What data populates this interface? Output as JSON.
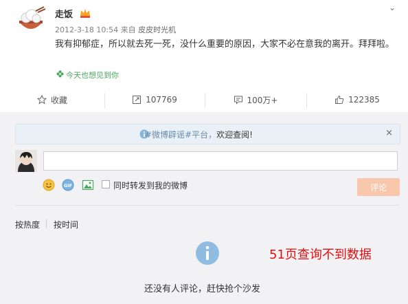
{
  "post": {
    "username": "走饭",
    "timestamp": "2012-3-18 10:54",
    "source_prefix": "来自",
    "source": "皮皮时光机",
    "text": "我有抑郁症，所以就去死一死，没什么重要的原因，大家不必在意我的离开。拜拜啦。",
    "location_line": "今天也想见到你"
  },
  "actions": {
    "favorite_label": "收藏",
    "repost_count": "107769",
    "comment_count": "100万+",
    "like_count": "122385"
  },
  "notice": {
    "hashtag": "#微博辟谣#平台，",
    "welcome": "欢迎查阅!",
    "close": "×"
  },
  "composer": {
    "input_value": "",
    "repost_checkbox_label": "同时转发到我的微博",
    "send_button": "评论",
    "repost_checked": false
  },
  "sort": {
    "by_hot": "按热度",
    "by_time": "按时间"
  },
  "empty_state": {
    "message": "还没有人评论，赶快抢个沙发"
  },
  "annotation": {
    "text": "51页查询不到数据",
    "color": "#e01010"
  },
  "colors": {
    "accent_send": "#f8c7ac",
    "location_green": "#4aa85e",
    "notice_blue": "#6a8cae"
  }
}
